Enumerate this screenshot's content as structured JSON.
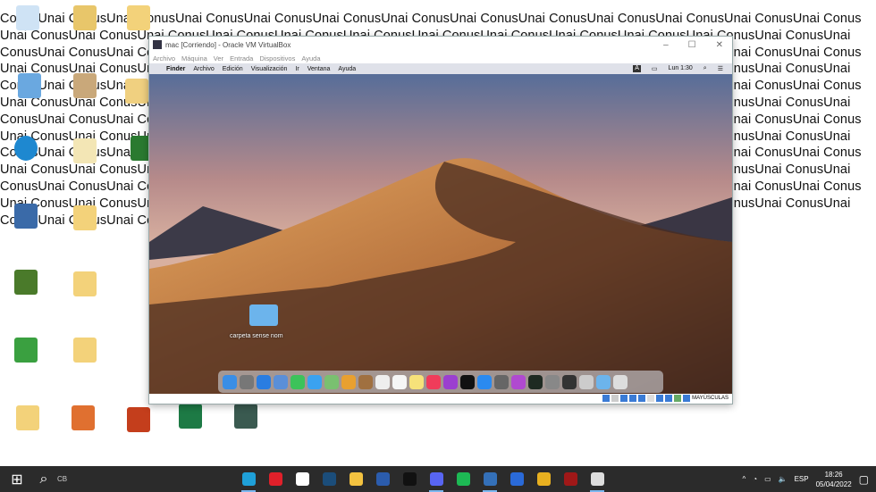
{
  "wallpaper": {
    "text": "ConusUnai",
    "repeat": 160
  },
  "vbox": {
    "title": "mac [Corriendo] - Oracle VM VirtualBox",
    "menu": [
      "Archivo",
      "Máquina",
      "Ver",
      "Entrada",
      "Dispositivos",
      "Ayuda"
    ],
    "status_text": "MAYÚSCULAS"
  },
  "mac": {
    "apple": "",
    "menu": [
      "Finder",
      "Archivo",
      "Edición",
      "Visualización",
      "Ir",
      "Ventana",
      "Ayuda"
    ],
    "clock": "Lun 1:30",
    "input_badge": "A",
    "folder_label": "carpeta sense nom",
    "dock": [
      {
        "name": "finder",
        "c": "#3a8ee6"
      },
      {
        "name": "launchpad",
        "c": "#777"
      },
      {
        "name": "safari",
        "c": "#2a7de1"
      },
      {
        "name": "mail",
        "c": "#5a8fd8"
      },
      {
        "name": "facetime",
        "c": "#3cc35a"
      },
      {
        "name": "messages",
        "c": "#3aa2f0"
      },
      {
        "name": "maps",
        "c": "#7ac070"
      },
      {
        "name": "photos",
        "c": "#e8a030"
      },
      {
        "name": "contacts",
        "c": "#a07040"
      },
      {
        "name": "calendar",
        "c": "#eee"
      },
      {
        "name": "reminders",
        "c": "#f5f5f5"
      },
      {
        "name": "notes",
        "c": "#f6e27a"
      },
      {
        "name": "music",
        "c": "#f03c5a"
      },
      {
        "name": "podcasts",
        "c": "#9b3fd0"
      },
      {
        "name": "tv",
        "c": "#111"
      },
      {
        "name": "app-store",
        "c": "#2a8af0"
      },
      {
        "name": "system-preferences",
        "c": "#666"
      },
      {
        "name": "feedback",
        "c": "#b04ad0"
      },
      {
        "name": "activity-monitor",
        "c": "#1e2a22"
      },
      {
        "name": "disk-utility",
        "c": "#888"
      },
      {
        "name": "preview",
        "c": "#333"
      },
      {
        "name": "utilities",
        "c": "#ccc"
      },
      {
        "name": "downloads",
        "c": "#6cb4ec"
      },
      {
        "name": "trash",
        "c": "#ddd"
      }
    ]
  },
  "taskbar": {
    "search_label": "CB",
    "lang": "ESP",
    "time": "18:26",
    "date": "05/04/2022",
    "apps": [
      {
        "name": "edge",
        "c": "#1fa0d8"
      },
      {
        "name": "opera",
        "c": "#e0202a"
      },
      {
        "name": "app3",
        "c": "#fff"
      },
      {
        "name": "steam",
        "c": "#1b4d7a"
      },
      {
        "name": "file-explorer",
        "c": "#f3c240"
      },
      {
        "name": "word",
        "c": "#2b5cad"
      },
      {
        "name": "epic-games",
        "c": "#111"
      },
      {
        "name": "discord",
        "c": "#5865f2"
      },
      {
        "name": "spotify",
        "c": "#1db954"
      },
      {
        "name": "virtualbox",
        "c": "#3470b8"
      },
      {
        "name": "app11",
        "c": "#2a6ad8"
      },
      {
        "name": "chrome",
        "c": "#e8b020"
      },
      {
        "name": "app13",
        "c": "#a01818"
      },
      {
        "name": "app14",
        "c": "#ddd"
      }
    ],
    "active": [
      0,
      7,
      9,
      13
    ]
  }
}
